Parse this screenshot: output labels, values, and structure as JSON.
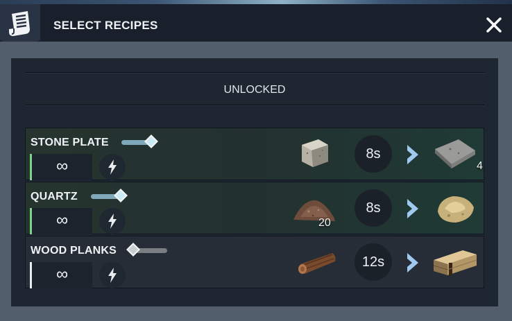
{
  "header": {
    "title": "SELECT RECIPES",
    "icon": "recipe-scroll-icon",
    "close_icon": "close-icon"
  },
  "tabs": [
    {
      "label": "UNLOCKED"
    }
  ],
  "recipes": [
    {
      "name": "STONE PLATE",
      "enabled": true,
      "slider_level": 0.75,
      "repeat_label": "∞",
      "boost_icon": "lightning-icon",
      "input_icon": "stone-block-icon",
      "input_qty": "",
      "time": "8s",
      "output_icon": "stone-plate-icon",
      "output_qty": "4"
    },
    {
      "name": "QUARTZ",
      "enabled": true,
      "slider_level": 0.75,
      "repeat_label": "∞",
      "boost_icon": "lightning-icon",
      "input_icon": "dirt-pile-icon",
      "input_qty": "20",
      "time": "8s",
      "output_icon": "quartz-icon",
      "output_qty": ""
    },
    {
      "name": "WOOD PLANKS",
      "enabled": false,
      "slider_level": 0.0,
      "repeat_label": "∞",
      "boost_icon": "lightning-icon",
      "input_icon": "log-icon",
      "input_qty": "",
      "time": "12s",
      "output_icon": "wood-planks-icon",
      "output_qty": ""
    }
  ],
  "colors": {
    "active_accent": "#7fd18d",
    "slider_active": "#a9e0ec",
    "slider_inactive": "#c9cdd0",
    "arrow": "#9fc9ee"
  }
}
